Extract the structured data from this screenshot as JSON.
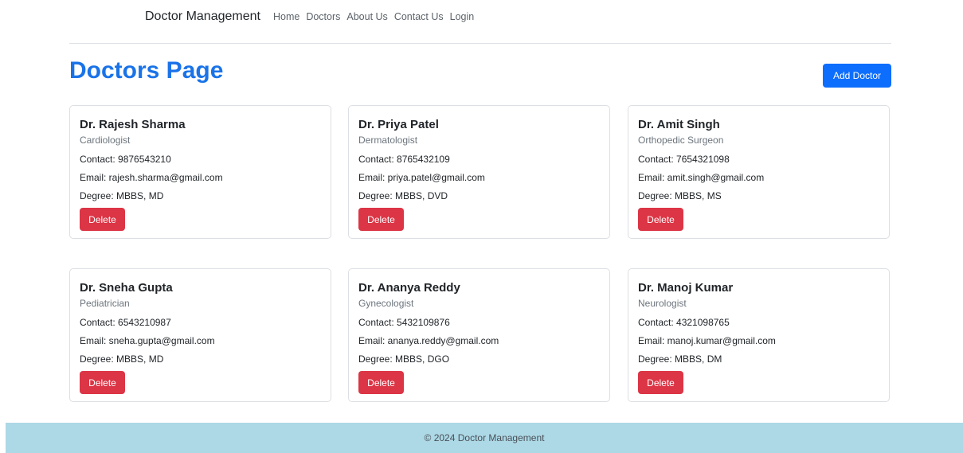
{
  "navbar": {
    "brand": "Doctor Management",
    "links": [
      "Home",
      "Doctors",
      "About Us",
      "Contact Us",
      "Login"
    ]
  },
  "page": {
    "title": "Doctors Page",
    "add_button_label": "Add Doctor"
  },
  "doctors": [
    {
      "name": "Dr. Rajesh Sharma",
      "specialty": "Cardiologist",
      "contact": "Contact: 9876543210",
      "email": "Email: rajesh.sharma@gmail.com",
      "degree": "Degree: MBBS, MD",
      "delete_label": "Delete"
    },
    {
      "name": "Dr. Priya Patel",
      "specialty": "Dermatologist",
      "contact": "Contact: 8765432109",
      "email": "Email: priya.patel@gmail.com",
      "degree": "Degree: MBBS, DVD",
      "delete_label": "Delete"
    },
    {
      "name": "Dr. Amit Singh",
      "specialty": "Orthopedic Surgeon",
      "contact": "Contact: 7654321098",
      "email": "Email: amit.singh@gmail.com",
      "degree": "Degree: MBBS, MS",
      "delete_label": "Delete"
    },
    {
      "name": "Dr. Sneha Gupta",
      "specialty": "Pediatrician",
      "contact": "Contact: 6543210987",
      "email": "Email: sneha.gupta@gmail.com",
      "degree": "Degree: MBBS, MD",
      "delete_label": "Delete"
    },
    {
      "name": "Dr. Ananya Reddy",
      "specialty": "Gynecologist",
      "contact": "Contact: 5432109876",
      "email": "Email: ananya.reddy@gmail.com",
      "degree": "Degree: MBBS, DGO",
      "delete_label": "Delete"
    },
    {
      "name": "Dr. Manoj Kumar",
      "specialty": "Neurologist",
      "contact": "Contact: 4321098765",
      "email": "Email: manoj.kumar@gmail.com",
      "degree": "Degree: MBBS, DM",
      "delete_label": "Delete"
    }
  ],
  "footer": {
    "text": "© 2024 Doctor Management"
  },
  "colors": {
    "title": "#1a73e8",
    "primary_button": "#0d6efd",
    "danger_button": "#dc3545",
    "footer_bg": "#add8e6"
  }
}
